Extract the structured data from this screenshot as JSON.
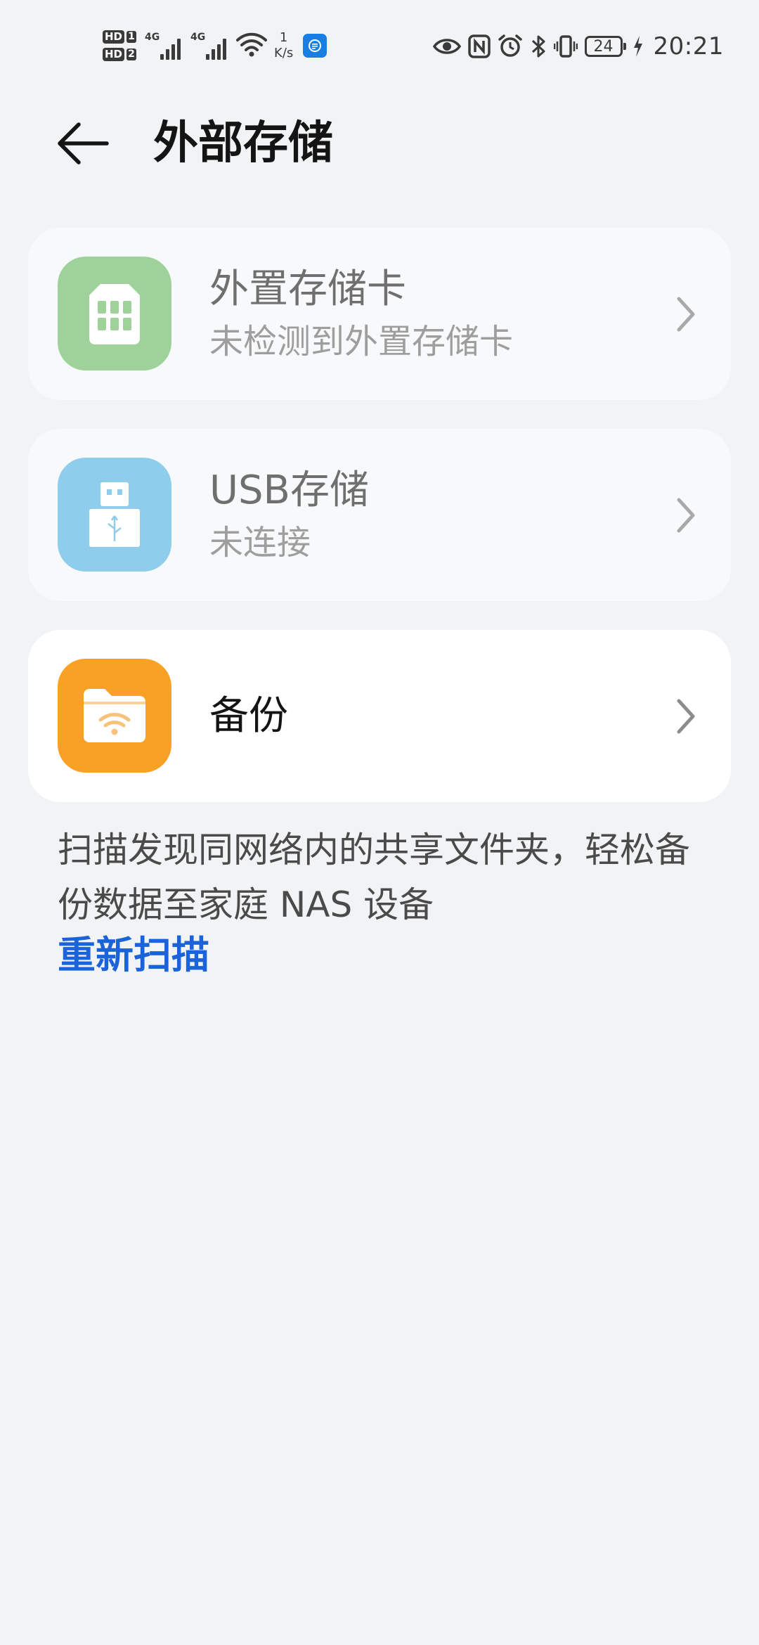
{
  "status_bar": {
    "hd1": "HD",
    "sim1": "1",
    "hd2": "HD",
    "sim2": "2",
    "net1": "4G",
    "net2": "4G",
    "speed_value": "1",
    "speed_unit": "K/s",
    "battery": "24",
    "time": "20:21"
  },
  "header": {
    "title": "外部存储"
  },
  "items": [
    {
      "title": "外置存储卡",
      "subtitle": "未检测到外置存储卡",
      "icon": "sd-card-icon",
      "color": "#9ed29a"
    },
    {
      "title": "USB存储",
      "subtitle": "未连接",
      "icon": "usb-icon",
      "color": "#8fcdec"
    },
    {
      "title": "备份",
      "icon": "folder-wifi-icon",
      "color": "#f8a125"
    }
  ],
  "description": {
    "text": "扫描发现同网络内的共享文件夹，轻松备份数据至家庭 NAS 设备",
    "link": "重新扫描",
    "link_color": "#1a63d8"
  }
}
